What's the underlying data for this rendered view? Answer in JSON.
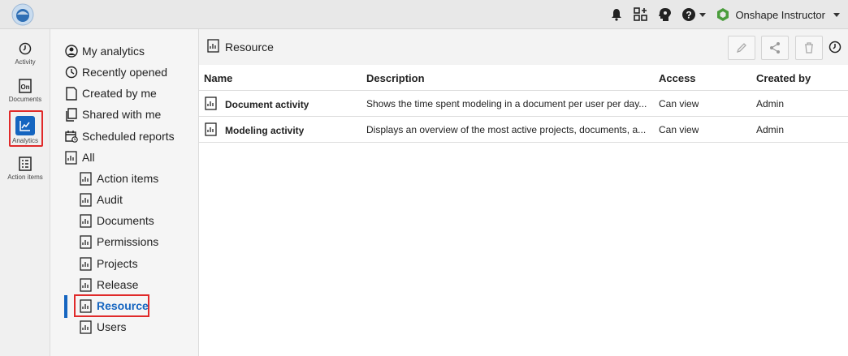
{
  "topbar": {
    "user_name": "Onshape Instructor"
  },
  "rail": {
    "items": [
      {
        "label": "Activity",
        "icon": "clock-icon"
      },
      {
        "label": "Documents",
        "icon": "onshape-doc-icon"
      },
      {
        "label": "Analytics",
        "icon": "analytics-chart-icon"
      },
      {
        "label": "Action items",
        "icon": "checklist-icon"
      }
    ]
  },
  "nav": {
    "items": [
      {
        "label": "My analytics",
        "icon": "user-circle-icon"
      },
      {
        "label": "Recently opened",
        "icon": "clock-icon"
      },
      {
        "label": "Created by me",
        "icon": "page-icon"
      },
      {
        "label": "Shared with me",
        "icon": "share-page-icon"
      },
      {
        "label": "Scheduled reports",
        "icon": "calendar-icon"
      },
      {
        "label": "All",
        "icon": "report-icon"
      }
    ],
    "subitems": [
      {
        "label": "Action items"
      },
      {
        "label": "Audit"
      },
      {
        "label": "Documents"
      },
      {
        "label": "Permissions"
      },
      {
        "label": "Projects"
      },
      {
        "label": "Release"
      },
      {
        "label": "Resource"
      },
      {
        "label": "Users"
      }
    ],
    "active": "Resource"
  },
  "main": {
    "title": "Resource",
    "columns": [
      "Name",
      "Description",
      "Access",
      "Created by"
    ],
    "rows": [
      {
        "name": "Document activity",
        "description": "Shows the time spent modeling in a document per user per day...",
        "access": "Can view",
        "created_by": "Admin"
      },
      {
        "name": "Modeling activity",
        "description": "Displays an overview of the most active projects, documents, a...",
        "access": "Can view",
        "created_by": "Admin"
      }
    ]
  },
  "colors": {
    "accent": "#1565c0",
    "highlight": "#e02a2a"
  }
}
